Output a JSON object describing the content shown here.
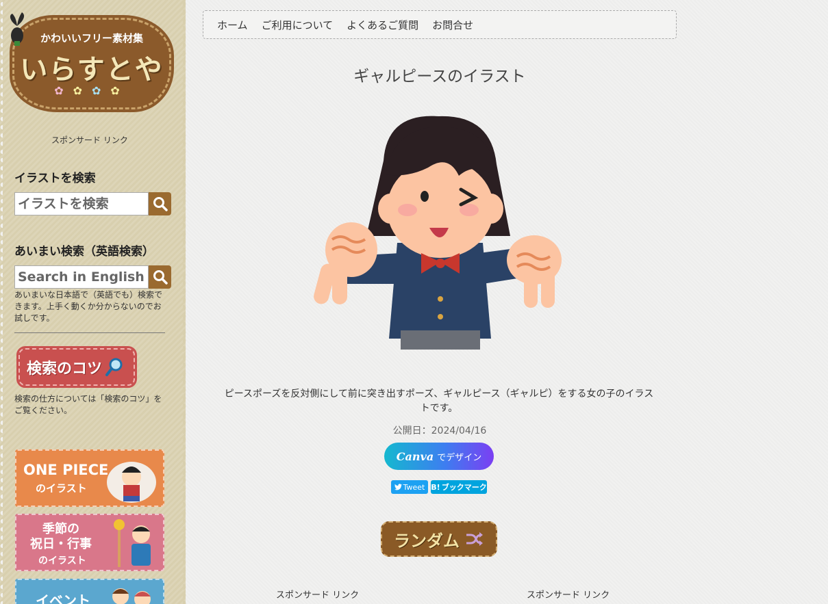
{
  "logo": {
    "tagline": "かわいいフリー素材集",
    "name": "いらすとや",
    "flowers": "✿✿✿✿"
  },
  "sidebar": {
    "sponsor_label": "スポンサード リンク",
    "search_heading": "イラストを検索",
    "search_placeholder": "イラストを検索",
    "fuzzy_heading": "あいまい検索（英語検索）",
    "fuzzy_placeholder": "Search in English",
    "fuzzy_note": "あいまいな日本語で（英語でも）検索できます。上手く動くか分からないのでお試しです。",
    "tips_button": "検索のコツ",
    "tips_note": "検索の仕方については「検索のコツ」をご覧ください。",
    "banners": [
      {
        "title": "ONE PIECE",
        "subtitle": "のイラスト"
      },
      {
        "title": "季節の\n祝日・行事",
        "subtitle": "のイラスト"
      },
      {
        "title": "イベント",
        "subtitle": ""
      }
    ]
  },
  "nav": {
    "items": [
      "ホーム",
      "ご利用について",
      "よくあるご質問",
      "お問合せ"
    ]
  },
  "post": {
    "title": "ギャルピースのイラスト",
    "description": "ピースポーズを反対側にして前に突き出すポーズ、ギャルピース（ギャルピ）をする女の子のイラストです。",
    "date": "公開日：2024/04/16",
    "canva_logo": "Canva",
    "canva_text": "でデザイン",
    "tweet": "Tweet",
    "hatena": "ブックマーク",
    "hatena_b": "B!",
    "random": "ランダム"
  },
  "footer": {
    "sponsor_left": "スポンサード リンク",
    "sponsor_right": "スポンサード リンク"
  },
  "colors": {
    "sidebar_bg": "#d8cfae",
    "logo_brown": "#8b5a2b",
    "search_btn": "#9a6a2f",
    "tips_red": "#c9504f",
    "tweet_blue": "#1da1f2",
    "hatena_blue": "#00a4de"
  }
}
